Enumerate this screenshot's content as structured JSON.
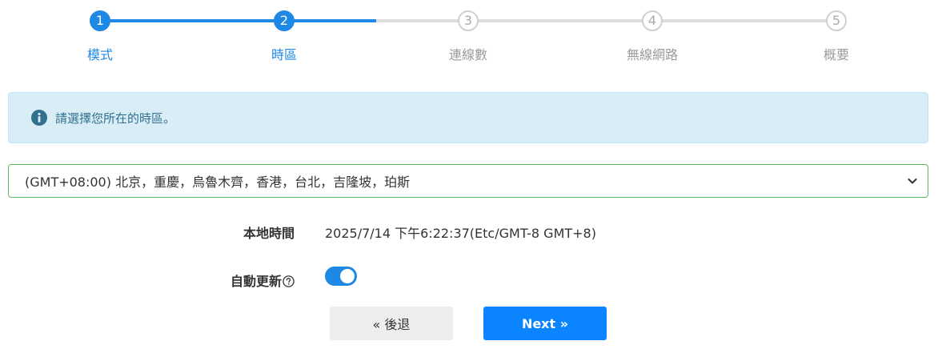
{
  "stepper": {
    "steps": [
      {
        "number": "1",
        "label": "模式",
        "state": "done"
      },
      {
        "number": "2",
        "label": "時區",
        "state": "done"
      },
      {
        "number": "3",
        "label": "連線數",
        "state": "todo"
      },
      {
        "number": "4",
        "label": "無線網路",
        "state": "todo"
      },
      {
        "number": "5",
        "label": "概要",
        "state": "todo"
      }
    ]
  },
  "alert": {
    "icon": "info-circle-icon",
    "text": "請選擇您所在的時區。"
  },
  "timezone": {
    "selected": "(GMT+08:00) 北京，重慶，烏魯木齊，香港，台北，吉隆坡，珀斯"
  },
  "local_time": {
    "label": "本地時間",
    "value": "2025/7/14 下午6:22:37(Etc/GMT-8 GMT+8)"
  },
  "auto_update": {
    "label": "自動更新",
    "enabled": true
  },
  "buttons": {
    "back": "« 後退",
    "next": "Next »"
  },
  "colors": {
    "accent": "#1e88e5",
    "next_button": "#0a84ff",
    "alert_bg": "#d9edf7",
    "alert_text": "#31708f",
    "select_border": "#5cb85c"
  }
}
